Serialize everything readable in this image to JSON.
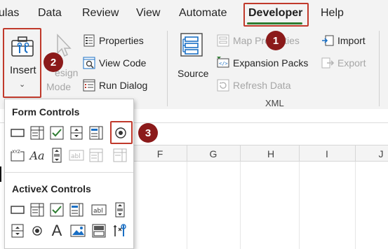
{
  "menubar": {
    "tabs": [
      "ulas",
      "Data",
      "Review",
      "View",
      "Automate",
      "Developer",
      "Help"
    ],
    "active_tab": "Developer"
  },
  "ribbon": {
    "insert_label": "Insert",
    "design_mode_top": "esign",
    "design_mode_bottom": "Mode",
    "properties": "Properties",
    "view_code": "View Code",
    "run_dialog": "Run Dialog",
    "source": "Source",
    "map_properties": "Map Properties",
    "expansion_packs": "Expansion Packs",
    "refresh_data": "Refresh Data",
    "xml_group": "XML",
    "import": "Import",
    "export": "Export"
  },
  "dropdown": {
    "form_controls": "Form Controls",
    "activex_controls": "ActiveX Controls",
    "form_icons": [
      "button-icon",
      "combo-box-icon",
      "checkbox-icon",
      "spin-button-icon",
      "list-box-icon",
      "option-button-icon",
      "group-box-icon",
      "label-icon",
      "scroll-bar-icon",
      "text-field-icon",
      "combo-list-edit-icon",
      "combo-drop-down-edit-icon"
    ],
    "activex_icons": [
      "command-button-icon",
      "combo-box-icon",
      "checkbox-icon",
      "list-box-icon",
      "text-box-icon",
      "scroll-bar-icon",
      "spin-button-icon",
      "option-button-icon",
      "label-icon",
      "image-icon",
      "toggle-button-icon",
      "more-controls-icon"
    ]
  },
  "sheet": {
    "columns": [
      "F",
      "G",
      "H",
      "I",
      "J"
    ]
  },
  "badges": [
    "1",
    "2",
    "3"
  ],
  "colors": {
    "highlight": "#c0392b",
    "badge": "#8b1a1a",
    "accent": "#2e7d32"
  }
}
